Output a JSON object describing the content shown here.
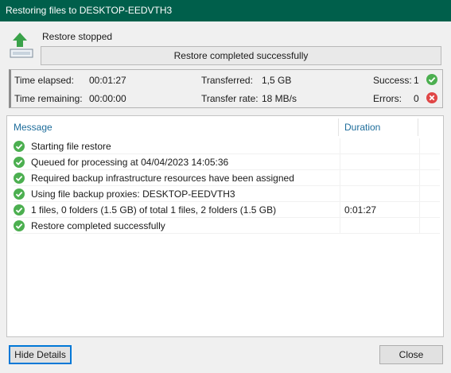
{
  "window": {
    "title": "Restoring files to DESKTOP-EEDVTH3"
  },
  "status": {
    "icon": "restore-upload-icon",
    "label": "Restore stopped",
    "progress_text": "Restore completed successfully",
    "progress_fraction": 1.0
  },
  "stats": {
    "time_elapsed_label": "Time elapsed:",
    "time_elapsed": "00:01:27",
    "time_remaining_label": "Time remaining:",
    "time_remaining": "00:00:00",
    "transferred_label": "Transferred:",
    "transferred": "1,5 GB",
    "transfer_rate_label": "Transfer rate:",
    "transfer_rate": "18 MB/s",
    "success_label": "Success:",
    "success": "1",
    "success_icon": "success-check-icon",
    "errors_label": "Errors:",
    "errors": "0",
    "errors_icon": "error-x-icon"
  },
  "log": {
    "columns": {
      "message": "Message",
      "duration": "Duration"
    },
    "rows": [
      {
        "message": "Starting file restore",
        "duration": ""
      },
      {
        "message": "Queued for processing at 04/04/2023 14:05:36",
        "duration": ""
      },
      {
        "message": "Required backup infrastructure resources have been assigned",
        "duration": ""
      },
      {
        "message": "Using file backup proxies: DESKTOP-EEDVTH3",
        "duration": ""
      },
      {
        "message": "1 files, 0 folders (1.5 GB) of total 1 files, 2 folders (1.5 GB)",
        "duration": "0:01:27"
      },
      {
        "message": "Restore completed successfully",
        "duration": ""
      }
    ]
  },
  "buttons": {
    "hide_details": "Hide Details",
    "close": "Close"
  },
  "colors": {
    "titlebar": "#005f4b",
    "success": "#4caf50",
    "error": "#e04646",
    "accent": "#0078d7"
  }
}
